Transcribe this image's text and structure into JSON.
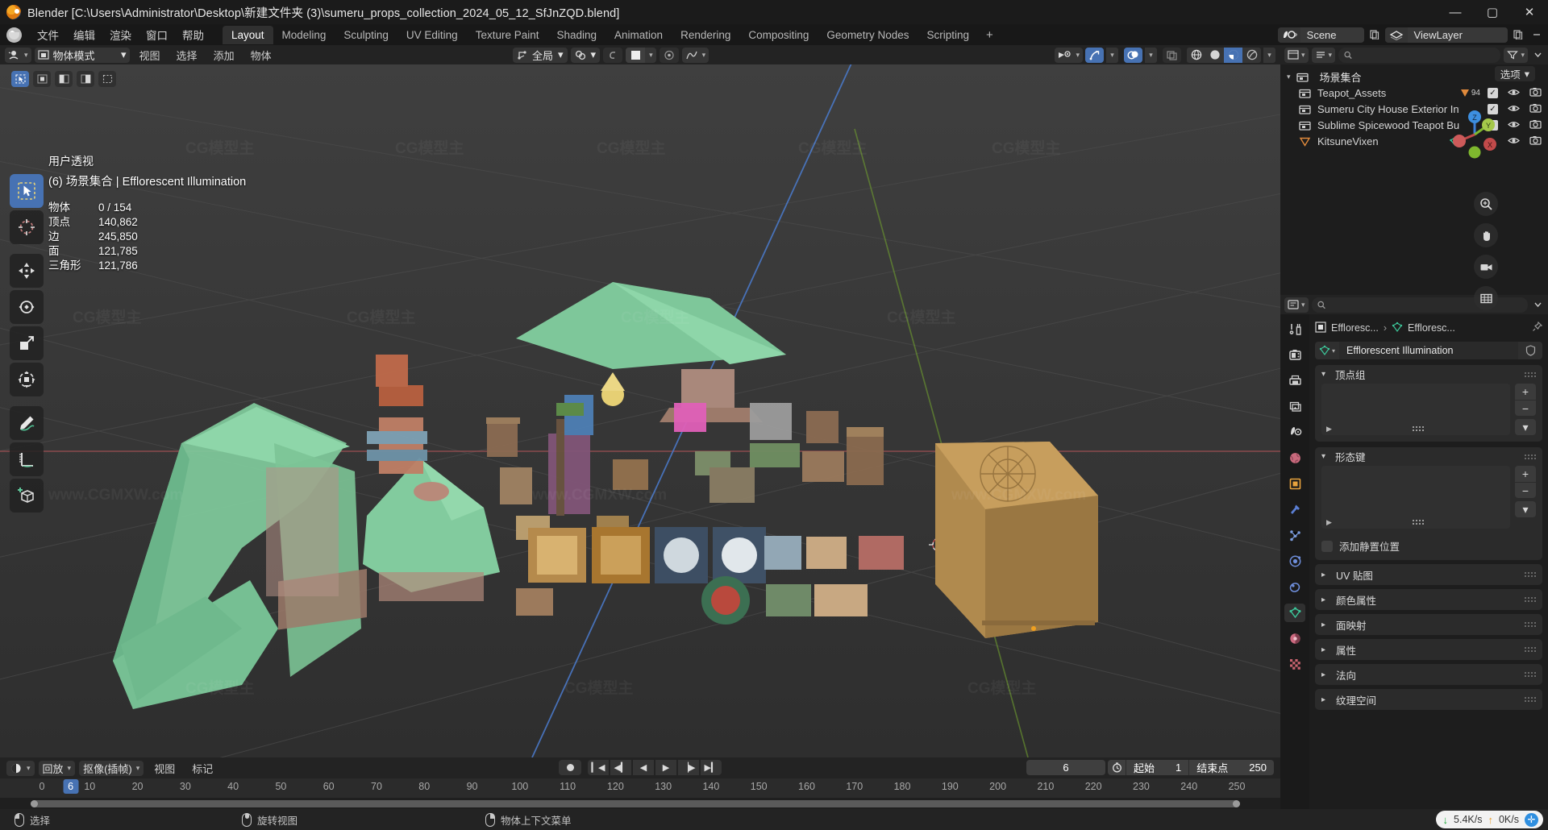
{
  "window": {
    "title": "Blender [C:\\Users\\Administrator\\Desktop\\新建文件夹 (3)\\sumeru_props_collection_2024_05_12_SfJnZQD.blend]",
    "minimize": "—",
    "maximize": "▢",
    "close": "✕"
  },
  "topbar": {
    "menus": [
      "文件",
      "编辑",
      "渲染",
      "窗口",
      "帮助"
    ],
    "workspaces": [
      {
        "label": "Layout",
        "active": true
      },
      {
        "label": "Modeling",
        "active": false
      },
      {
        "label": "Sculpting",
        "active": false
      },
      {
        "label": "UV Editing",
        "active": false
      },
      {
        "label": "Texture Paint",
        "active": false
      },
      {
        "label": "Shading",
        "active": false
      },
      {
        "label": "Animation",
        "active": false
      },
      {
        "label": "Rendering",
        "active": false
      },
      {
        "label": "Compositing",
        "active": false
      },
      {
        "label": "Geometry Nodes",
        "active": false
      },
      {
        "label": "Scripting",
        "active": false
      }
    ],
    "add_workspace": "+",
    "scene_name": "Scene",
    "viewlayer_name": "ViewLayer"
  },
  "viewport_header": {
    "editor_type_icon": "editor-type-icon",
    "mode": "物体模式",
    "menus": [
      "视图",
      "选择",
      "添加",
      "物体"
    ],
    "transform_orientation": "全局",
    "snap_icon": "magnet-icon",
    "proportional_icon": "proportional-edit-icon"
  },
  "viewport": {
    "options_label": "选项",
    "overlay": {
      "view_name": "用户透视",
      "collection_line": "(6) 场景集合 | Efflorescent Illumination",
      "stats": [
        {
          "key": "物体",
          "value": "0 / 154"
        },
        {
          "key": "顶点",
          "value": "140,862"
        },
        {
          "key": "边",
          "value": "245,850"
        },
        {
          "key": "面",
          "value": "121,785"
        },
        {
          "key": "三角形",
          "value": "121,786"
        }
      ]
    },
    "gizmo_axes": [
      "X",
      "Y",
      "Z"
    ],
    "watermark": "CG模型主 www.CGMXW.com",
    "tools": [
      "tweak-select-tool",
      "cursor-tool",
      "move-tool",
      "rotate-tool",
      "scale-tool",
      "transform-tool",
      "annotate-tool",
      "measure-tool",
      "add-cube-tool"
    ]
  },
  "outliner": {
    "search_placeholder": "",
    "root": "场景集合",
    "items": [
      {
        "name": "Teapot_Assets",
        "icon": "collection-icon",
        "badge": "94",
        "checkbox": true,
        "eye": true,
        "camera": true
      },
      {
        "name": "Sumeru City House Exterior Inte",
        "icon": "collection-icon",
        "badge": "",
        "checkbox": true,
        "eye": true,
        "camera": true
      },
      {
        "name": "Sublime Spicewood Teapot Buil",
        "icon": "collection-icon",
        "badge": "",
        "checkbox": true,
        "eye": true,
        "camera": true
      },
      {
        "name": "KitsuneVixen",
        "icon": "mesh-data-icon",
        "badge": "",
        "checkbox": false,
        "eye": true,
        "camera": true
      }
    ]
  },
  "properties": {
    "breadcrumb": [
      "Effloresc...",
      "Effloresc..."
    ],
    "object_name": "Efflorescent Illumination",
    "tabs": [
      "tool-tab",
      "render-tab",
      "output-tab",
      "view-layer-tab",
      "scene-tab",
      "world-tab",
      "object-tab",
      "modifier-tab",
      "particles-tab",
      "physics-tab",
      "constraints-tab",
      "object-data-tab",
      "material-tab",
      "texture-tab"
    ],
    "active_tab": "object-data-tab",
    "panels": [
      {
        "label": "顶点组",
        "expanded": true
      },
      {
        "label": "形态键",
        "expanded": true
      }
    ],
    "vertex_group_add": "+",
    "vertex_group_remove": "−",
    "shapekey_add": "+",
    "shapekey_remove": "−",
    "rest_position_label": "添加静置位置",
    "collapsed_panels": [
      "UV 贴图",
      "颜色属性",
      "面映射",
      "属性",
      "法向",
      "纹理空间"
    ]
  },
  "timeline": {
    "editor_icon": "timeline-editor-icon",
    "menus": [
      "回放",
      "抠像(插帧)",
      "视图",
      "标记"
    ],
    "playback_label": "回放",
    "keying_label": "抠像(插帧)",
    "view_label": "视图",
    "marker_label": "标记",
    "current_frame": "6",
    "start_label": "起始",
    "start_value": "1",
    "end_label": "结束点",
    "end_value": "250",
    "ticks": [
      0,
      10,
      20,
      30,
      40,
      50,
      60,
      70,
      80,
      90,
      100,
      110,
      120,
      130,
      140,
      150,
      160,
      170,
      180,
      190,
      200,
      210,
      220,
      230,
      240,
      250
    ],
    "playhead_frame": "6"
  },
  "statusbar": {
    "left_mouse_action": "选择",
    "middle_mouse_action": "旋转视图",
    "right_mouse_action": "物体上下文菜单",
    "download_rate": "5.4K/s",
    "upload_rate": "0K/s"
  },
  "colors": {
    "accent": "#4772b3",
    "panel": "#2b2b2b",
    "header": "#232323",
    "background": "#1d1d1d",
    "x_axis": "#c24a4a",
    "y_axis": "#7fb82e",
    "z_axis": "#3d7fd6"
  }
}
